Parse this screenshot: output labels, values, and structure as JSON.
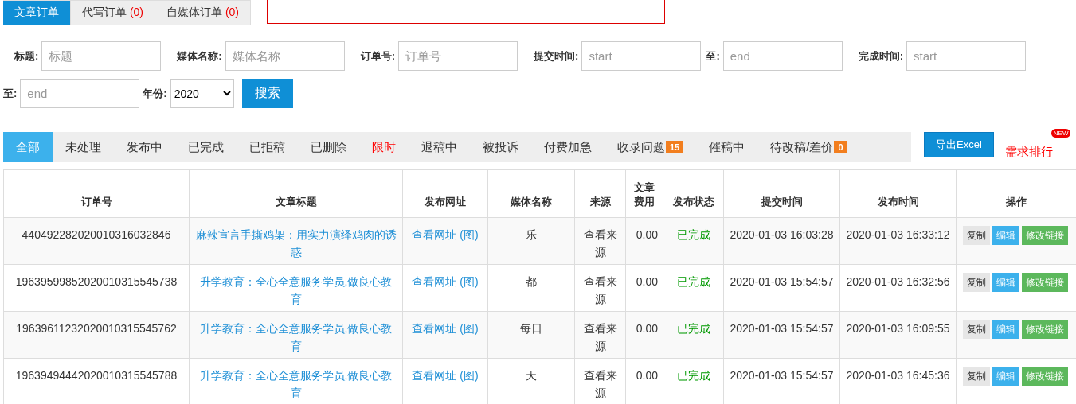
{
  "top_tabs": [
    {
      "label": "文章订单",
      "selected": true
    },
    {
      "label": "代写订单",
      "count": "(0)",
      "selected": false
    },
    {
      "label": "自媒体订单",
      "count": "(0)",
      "selected": false
    }
  ],
  "notice": {
    "shown": true
  },
  "filters": [
    {
      "kind": "input",
      "label": "标题:",
      "placeholder": "标题"
    },
    {
      "kind": "input",
      "label": "媒体名称:",
      "placeholder": "媒体名称"
    },
    {
      "kind": "input",
      "label": "订单号:",
      "placeholder": "订单号"
    },
    {
      "kind": "input",
      "label": "提交时间:",
      "placeholder": "start"
    },
    {
      "kind": "input",
      "label": "至:",
      "placeholder": "end"
    },
    {
      "kind": "input",
      "label": "完成时间:",
      "placeholder": "start"
    },
    {
      "kind": "input",
      "label": "至:",
      "placeholder": "end"
    },
    {
      "kind": "select",
      "label": "年份:",
      "value": "2020"
    }
  ],
  "search_button": "搜索",
  "status_tabs": [
    {
      "label": "全部",
      "selected": true,
      "urgent": false
    },
    {
      "label": "未处理",
      "selected": false,
      "urgent": false
    },
    {
      "label": "发布中",
      "selected": false,
      "urgent": false
    },
    {
      "label": "已完成",
      "selected": false,
      "urgent": false
    },
    {
      "label": "已拒稿",
      "selected": false,
      "urgent": false
    },
    {
      "label": "已删除",
      "selected": false,
      "urgent": false
    },
    {
      "label": "限时",
      "selected": false,
      "urgent": true
    },
    {
      "label": "退稿中",
      "selected": false,
      "urgent": false
    },
    {
      "label": "被投诉",
      "selected": false,
      "urgent": false
    },
    {
      "label": "付费加急",
      "selected": false,
      "urgent": false
    },
    {
      "label": "收录问题",
      "badge": "15",
      "selected": false,
      "urgent": false
    },
    {
      "label": "催稿中",
      "selected": false,
      "urgent": false
    },
    {
      "label": "待改稿/差价",
      "badge": "0",
      "selected": false,
      "urgent": false
    }
  ],
  "export_button": "导出Excel",
  "ranking_link": {
    "label": "需求排行",
    "badge": "NEW"
  },
  "table": {
    "columns": [
      "订单号",
      "文章标题",
      "发布网址",
      "媒体名称",
      "来源",
      "文章费用",
      "发布状态",
      "提交时间",
      "发布时间",
      "操作"
    ],
    "rows": [
      {
        "order_no": "440492282020010316032846",
        "title": "麻辣宣言手撕鸡架：用实力演绎鸡肉的诱惑",
        "url": "查看网址 (图)",
        "media": "乐",
        "source": "查看来源",
        "fee": "0.00",
        "status": "已完成",
        "submitted": "2020-01-03 16:03:28",
        "published": "2020-01-03 16:33:12",
        "actions": [
          {
            "kind": "copy",
            "label": "复制"
          },
          {
            "kind": "edit",
            "label": "编辑"
          },
          {
            "kind": "link",
            "label": "修改链接"
          }
        ]
      },
      {
        "order_no": "19639599852020010315545738",
        "title": "升学教育：全心全意服务学员,做良心教育",
        "url": "查看网址 (图)",
        "media": "都",
        "source": "查看来源",
        "fee": "0.00",
        "status": "已完成",
        "submitted": "2020-01-03 15:54:57",
        "published": "2020-01-03 16:32:56",
        "actions": [
          {
            "kind": "copy",
            "label": "复制"
          },
          {
            "kind": "edit",
            "label": "编辑"
          },
          {
            "kind": "link",
            "label": "修改链接"
          }
        ]
      },
      {
        "order_no": "19639611232020010315545762",
        "title": "升学教育：全心全意服务学员,做良心教育",
        "url": "查看网址 (图)",
        "media": "每日",
        "source": "查看来源",
        "fee": "0.00",
        "status": "已完成",
        "submitted": "2020-01-03 15:54:57",
        "published": "2020-01-03 16:09:55",
        "actions": [
          {
            "kind": "copy",
            "label": "复制"
          },
          {
            "kind": "edit",
            "label": "编辑"
          },
          {
            "kind": "link",
            "label": "修改链接"
          }
        ]
      },
      {
        "order_no": "19639494442020010315545788",
        "title": "升学教育：全心全意服务学员,做良心教育",
        "url": "查看网址 (图)",
        "media": "天",
        "source": "查看来源",
        "fee": "0.00",
        "status": "已完成",
        "submitted": "2020-01-03 15:54:57",
        "published": "2020-01-03 16:45:36",
        "actions": [
          {
            "kind": "copy",
            "label": "复制"
          },
          {
            "kind": "edit",
            "label": "编辑"
          },
          {
            "kind": "link",
            "label": "修改链接"
          }
        ]
      }
    ]
  }
}
